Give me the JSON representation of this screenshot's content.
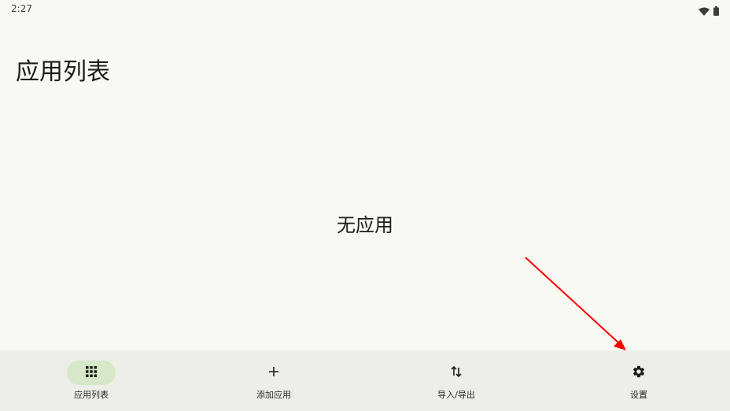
{
  "status_bar": {
    "time": "2:27",
    "icons": [
      "wifi-icon",
      "battery-icon"
    ]
  },
  "header": {
    "title": "应用列表"
  },
  "main": {
    "empty_message": "无应用"
  },
  "bottom_nav": {
    "items": [
      {
        "label": "应用列表",
        "icon": "grid-icon",
        "active": true
      },
      {
        "label": "添加应用",
        "icon": "plus-icon",
        "active": false
      },
      {
        "label": "导入/导出",
        "icon": "swap-vertical-icon",
        "active": false
      },
      {
        "label": "设置",
        "icon": "gear-icon",
        "active": false
      }
    ]
  },
  "colors": {
    "background": "#f7f9f2",
    "nav_background": "#eceee7",
    "active_indicator": "#d6e8c8",
    "annotation_arrow": "#ff0000"
  }
}
